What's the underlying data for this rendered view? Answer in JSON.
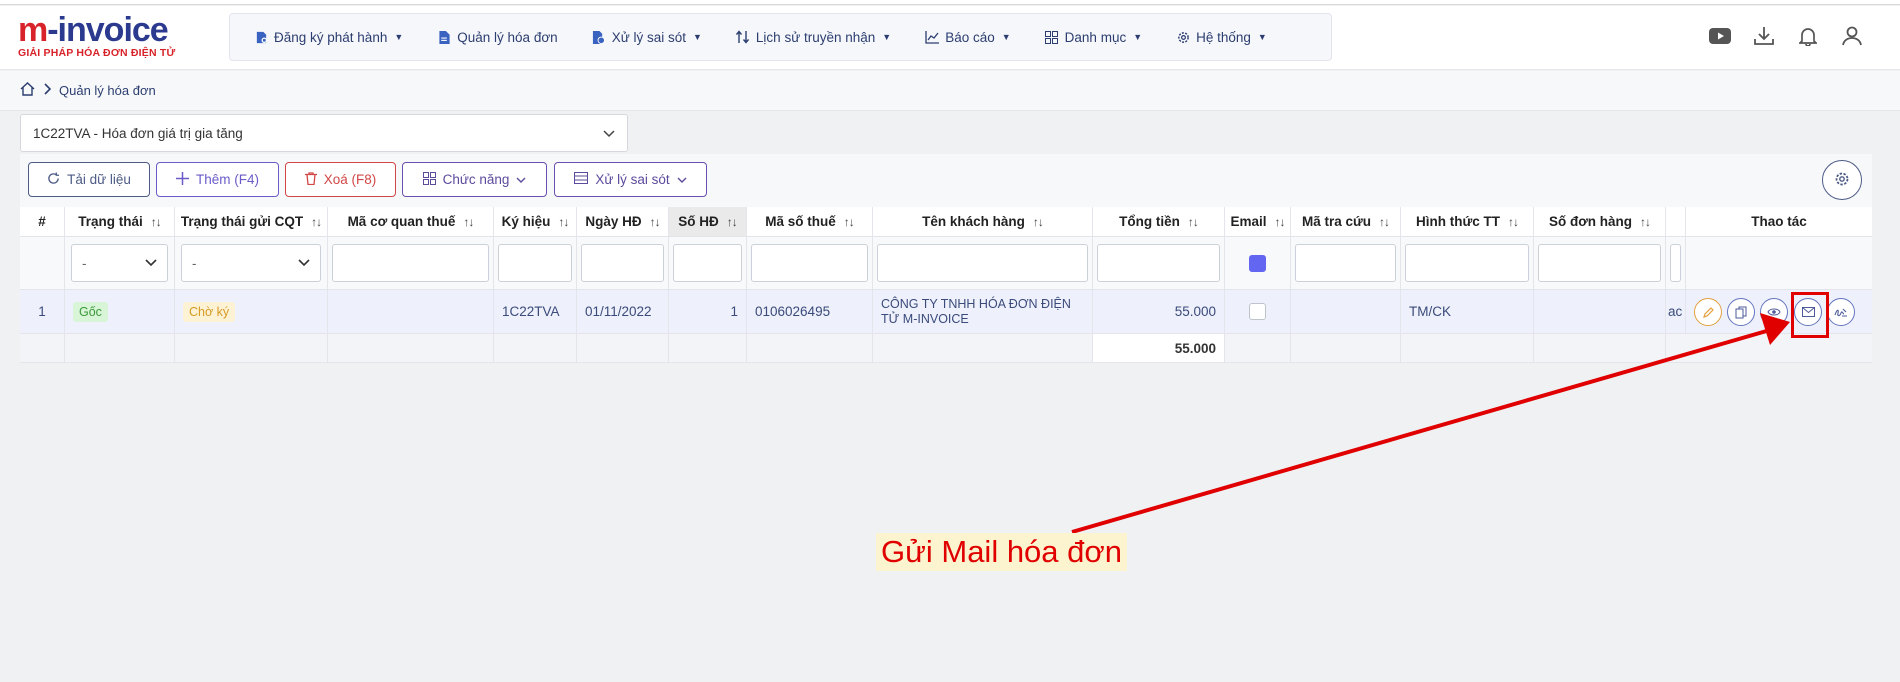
{
  "logo": {
    "brand_m": "m",
    "brand_rest": "-invoice",
    "tagline": "GIẢI PHÁP HÓA ĐƠN ĐIỆN TỬ"
  },
  "nav": {
    "items": [
      {
        "label": "Đăng ký phát hành",
        "icon": "document-settings-icon",
        "dropdown": true
      },
      {
        "label": "Quản lý hóa đơn",
        "icon": "document-icon",
        "dropdown": false
      },
      {
        "label": "Xử lý sai sót",
        "icon": "document-error-icon",
        "dropdown": true
      },
      {
        "label": "Lịch sử truyền nhận",
        "icon": "up-down-arrows-icon",
        "dropdown": true
      },
      {
        "label": "Báo cáo",
        "icon": "chart-line-icon",
        "dropdown": true
      },
      {
        "label": "Danh mục",
        "icon": "grid-icon",
        "dropdown": true
      },
      {
        "label": "Hệ thống",
        "icon": "gear-icon",
        "dropdown": true
      }
    ]
  },
  "breadcrumb": {
    "current": "Quản lý hóa đơn"
  },
  "series_select": {
    "value": "1C22TVA - Hóa đơn giá trị gia tăng"
  },
  "toolbar": {
    "reload": "Tải dữ liệu",
    "add": "Thêm (F4)",
    "delete": "Xoá (F8)",
    "functions": "Chức năng",
    "errors": "Xử lý sai sót"
  },
  "table": {
    "headers": [
      "#",
      "Trạng thái",
      "Trạng thái gửi CQT",
      "Mã cơ quan thuế",
      "Ký hiệu",
      "Ngày HĐ",
      "Số HĐ",
      "Mã số thuế",
      "Tên khách hàng",
      "Tổng tiền",
      "Email",
      "Mã tra cứu",
      "Hình thức TT",
      "Số đơn hàng",
      "",
      "Thao tác"
    ],
    "filter_select_placeholder": "-",
    "row": {
      "index": "1",
      "status": "Gốc",
      "cqt_status": "Chờ ký",
      "tax_office_code": "",
      "symbol": "1C22TVA",
      "date": "01/11/2022",
      "number": "1",
      "tax_code": "0106026495",
      "customer": "CÔNG TY TNHH HÓA ĐƠN ĐIỆN TỬ M-INVOICE",
      "total": "55.000",
      "lookup_code": "",
      "payment": "TM/CK",
      "order_no": "",
      "extra": "ac"
    },
    "sum_total": "55.000"
  },
  "annotation": {
    "text": "Gửi Mail hóa đơn",
    "color": "#e00000"
  }
}
